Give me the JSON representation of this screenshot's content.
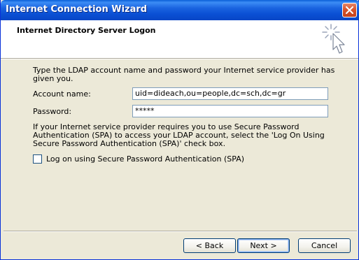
{
  "window": {
    "title": "Internet Connection Wizard",
    "header_title": "Internet Directory Server Logon"
  },
  "content": {
    "instruction": "Type the LDAP account name and password your Internet service provider has given you.",
    "account_label": "Account name:",
    "account_value": "uid=dideach,ou=people,dc=sch,dc=gr",
    "password_label": "Password:",
    "password_value": "*****",
    "spa_info": "If your Internet service provider requires you to use Secure Password Authentication (SPA) to access your LDAP account, select the 'Log On Using Secure Password Authentication (SPA)' check box.",
    "spa_checkbox_label": "Log on using Secure Password Authentication (SPA)",
    "spa_checked": false
  },
  "buttons": {
    "back": "< Back",
    "next": "Next >",
    "cancel": "Cancel"
  },
  "colors": {
    "titlebar": "#0a4fd4",
    "dialog_bg": "#ece9d8",
    "close_button": "#d9542b"
  },
  "icons": {
    "close": "close-icon",
    "wizard": "wizard-cursor-icon"
  }
}
